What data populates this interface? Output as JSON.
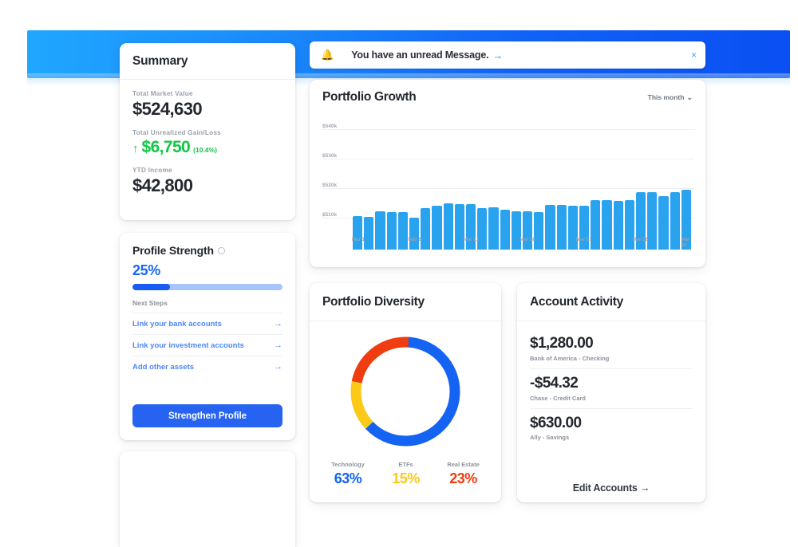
{
  "header": {
    "gradient_from": "#1fa7ff",
    "gradient_to": "#0a4ff2"
  },
  "notification": {
    "bell_icon": "bell-icon",
    "text": "You have an unread Message.",
    "arrow": "→",
    "close": "×"
  },
  "summary": {
    "title": "Summary",
    "rows": [
      {
        "label": "Total Market Value",
        "value": "$524,630"
      },
      {
        "label": "Total Unrealized Gain/Loss",
        "value": "$6,750",
        "pct": "(10.4%)",
        "arrow": "↑",
        "color": "#12c744"
      },
      {
        "label": "YTD Income",
        "value": "$42,800"
      }
    ]
  },
  "profile_strength": {
    "title": "Profile Strength",
    "info_icon": "info-icon",
    "percent_label": "25%",
    "percent_value": 25,
    "next_steps_label": "Next Steps",
    "steps": [
      {
        "label": "Link your bank accounts",
        "arrow": "→"
      },
      {
        "label": "Link your investment accounts",
        "arrow": "→"
      },
      {
        "label": "Add other assets",
        "arrow": "→"
      }
    ],
    "cta": "Strengthen Profile",
    "accent": "#2563f0"
  },
  "growth": {
    "title": "Portfolio Growth",
    "range_label": "This month",
    "chevron": "∨"
  },
  "diversity": {
    "title": "Portfolio Diversity"
  },
  "activity": {
    "title": "Account Activity",
    "items": [
      {
        "amount": "$1,280.00",
        "source": "Bank of America - Checking"
      },
      {
        "amount": "-$54.32",
        "source": "Chase - Credit Card"
      },
      {
        "amount": "$630.00",
        "source": "Ally - Savings"
      }
    ],
    "edit_link": "Edit Accounts →"
  },
  "chart_data": [
    {
      "type": "bar",
      "title": "Portfolio Growth",
      "xlabel": "",
      "ylabel": "",
      "ylim": [
        505000,
        545000
      ],
      "grid": true,
      "legend": "none",
      "ytick_labels": [
        "$540k",
        "$530k",
        "$520k",
        "$510k"
      ],
      "ytick_values": [
        540000,
        530000,
        520000,
        510000
      ],
      "xtick_labels": [
        "Mar 1",
        "Mar 6",
        "Mar 11",
        "Mar 16",
        "Mar 21",
        "Mar 26",
        "Mar 30"
      ],
      "xtick_indices": [
        0,
        5,
        10,
        15,
        20,
        25,
        29
      ],
      "categories": [
        "Mar 1",
        "Mar 2",
        "Mar 3",
        "Mar 4",
        "Mar 5",
        "Mar 6",
        "Mar 7",
        "Mar 8",
        "Mar 9",
        "Mar 10",
        "Mar 11",
        "Mar 12",
        "Mar 13",
        "Mar 14",
        "Mar 15",
        "Mar 16",
        "Mar 17",
        "Mar 18",
        "Mar 19",
        "Mar 20",
        "Mar 21",
        "Mar 22",
        "Mar 23",
        "Mar 24",
        "Mar 25",
        "Mar 26",
        "Mar 27",
        "Mar 28",
        "Mar 29",
        "Mar 30"
      ],
      "values": [
        516500,
        516200,
        518000,
        517800,
        517900,
        515800,
        519200,
        520100,
        520800,
        520600,
        520400,
        519200,
        519300,
        518600,
        518200,
        518000,
        517900,
        520200,
        520300,
        520000,
        520100,
        521800,
        521900,
        521700,
        521800,
        524600,
        524700,
        523200,
        524600,
        525400
      ],
      "bar_color": "#29a3ee"
    },
    {
      "type": "pie",
      "title": "Portfolio Diversity",
      "donut": true,
      "labels": [
        "Technology",
        "ETFs",
        "Real Estate"
      ],
      "values": [
        63,
        15,
        23
      ],
      "value_labels": [
        "63%",
        "15%",
        "23%"
      ],
      "colors": [
        "#1463f3",
        "#fbc916",
        "#f03c11"
      ],
      "legend": "bottom"
    }
  ]
}
